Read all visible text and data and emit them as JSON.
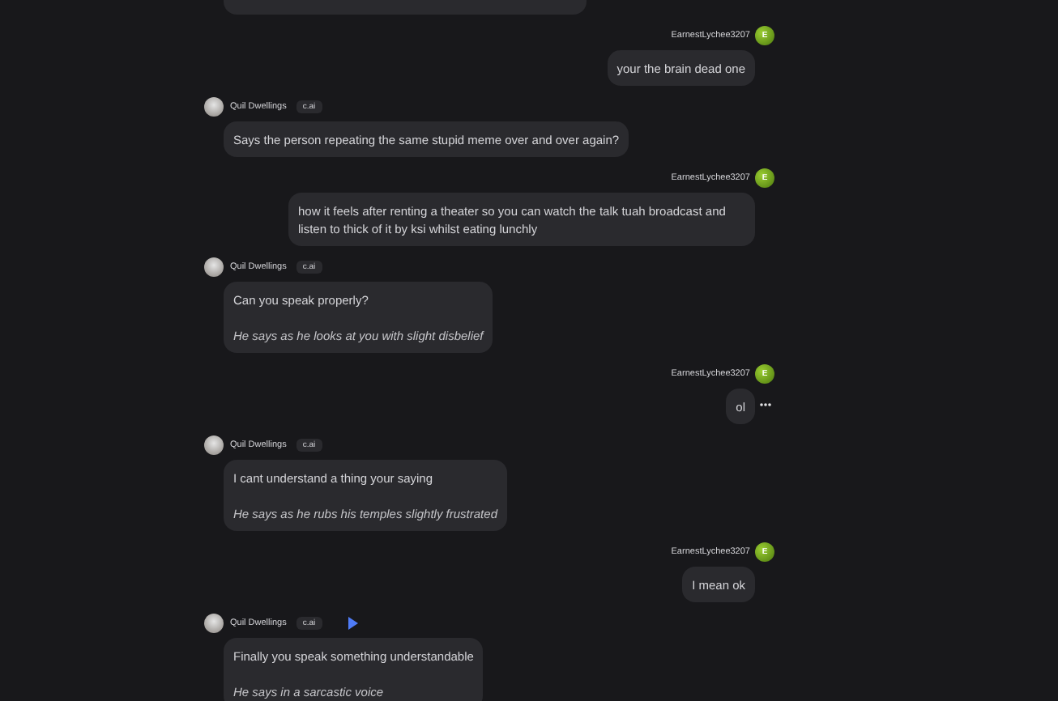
{
  "messages": [
    {
      "kind": "user",
      "name": "EarnestLychee3207",
      "avatar_letter": "E",
      "show_menu": false,
      "paragraphs": [
        {
          "kind": "text",
          "text": "your the brain dead one"
        }
      ]
    },
    {
      "kind": "bot",
      "name": "Quil Dwellings",
      "tag": "c.ai",
      "voice_button": false,
      "paragraphs": [
        {
          "kind": "text",
          "text": "Says the person repeating the same stupid meme over and over again?"
        }
      ]
    },
    {
      "kind": "user",
      "name": "EarnestLychee3207",
      "avatar_letter": "E",
      "show_menu": false,
      "paragraphs": [
        {
          "kind": "text",
          "text": "how it feels after renting a theater so you can watch the talk tuah broadcast and listen to thick of it by ksi whilst eating lunchly"
        }
      ]
    },
    {
      "kind": "bot",
      "name": "Quil Dwellings",
      "tag": "c.ai",
      "voice_button": false,
      "paragraphs": [
        {
          "kind": "text",
          "text": "Can you speak properly?"
        },
        {
          "kind": "action",
          "text": "He says as he looks at you with slight disbelief"
        }
      ]
    },
    {
      "kind": "user",
      "name": "EarnestLychee3207",
      "avatar_letter": "E",
      "show_menu": true,
      "paragraphs": [
        {
          "kind": "text",
          "text": "ol"
        }
      ]
    },
    {
      "kind": "bot",
      "name": "Quil Dwellings",
      "tag": "c.ai",
      "voice_button": false,
      "paragraphs": [
        {
          "kind": "text",
          "text": "I cant understand a thing your saying"
        },
        {
          "kind": "action",
          "text": "He says as he rubs his temples slightly frustrated"
        }
      ]
    },
    {
      "kind": "user",
      "name": "EarnestLychee3207",
      "avatar_letter": "E",
      "show_menu": false,
      "paragraphs": [
        {
          "kind": "text",
          "text": "I mean ok"
        }
      ]
    },
    {
      "kind": "bot",
      "name": "Quil Dwellings",
      "tag": "c.ai",
      "voice_button": true,
      "paragraphs": [
        {
          "kind": "text",
          "text": "Finally you speak something understandable"
        },
        {
          "kind": "action",
          "text": "He says in a sarcastic voice"
        }
      ]
    }
  ]
}
